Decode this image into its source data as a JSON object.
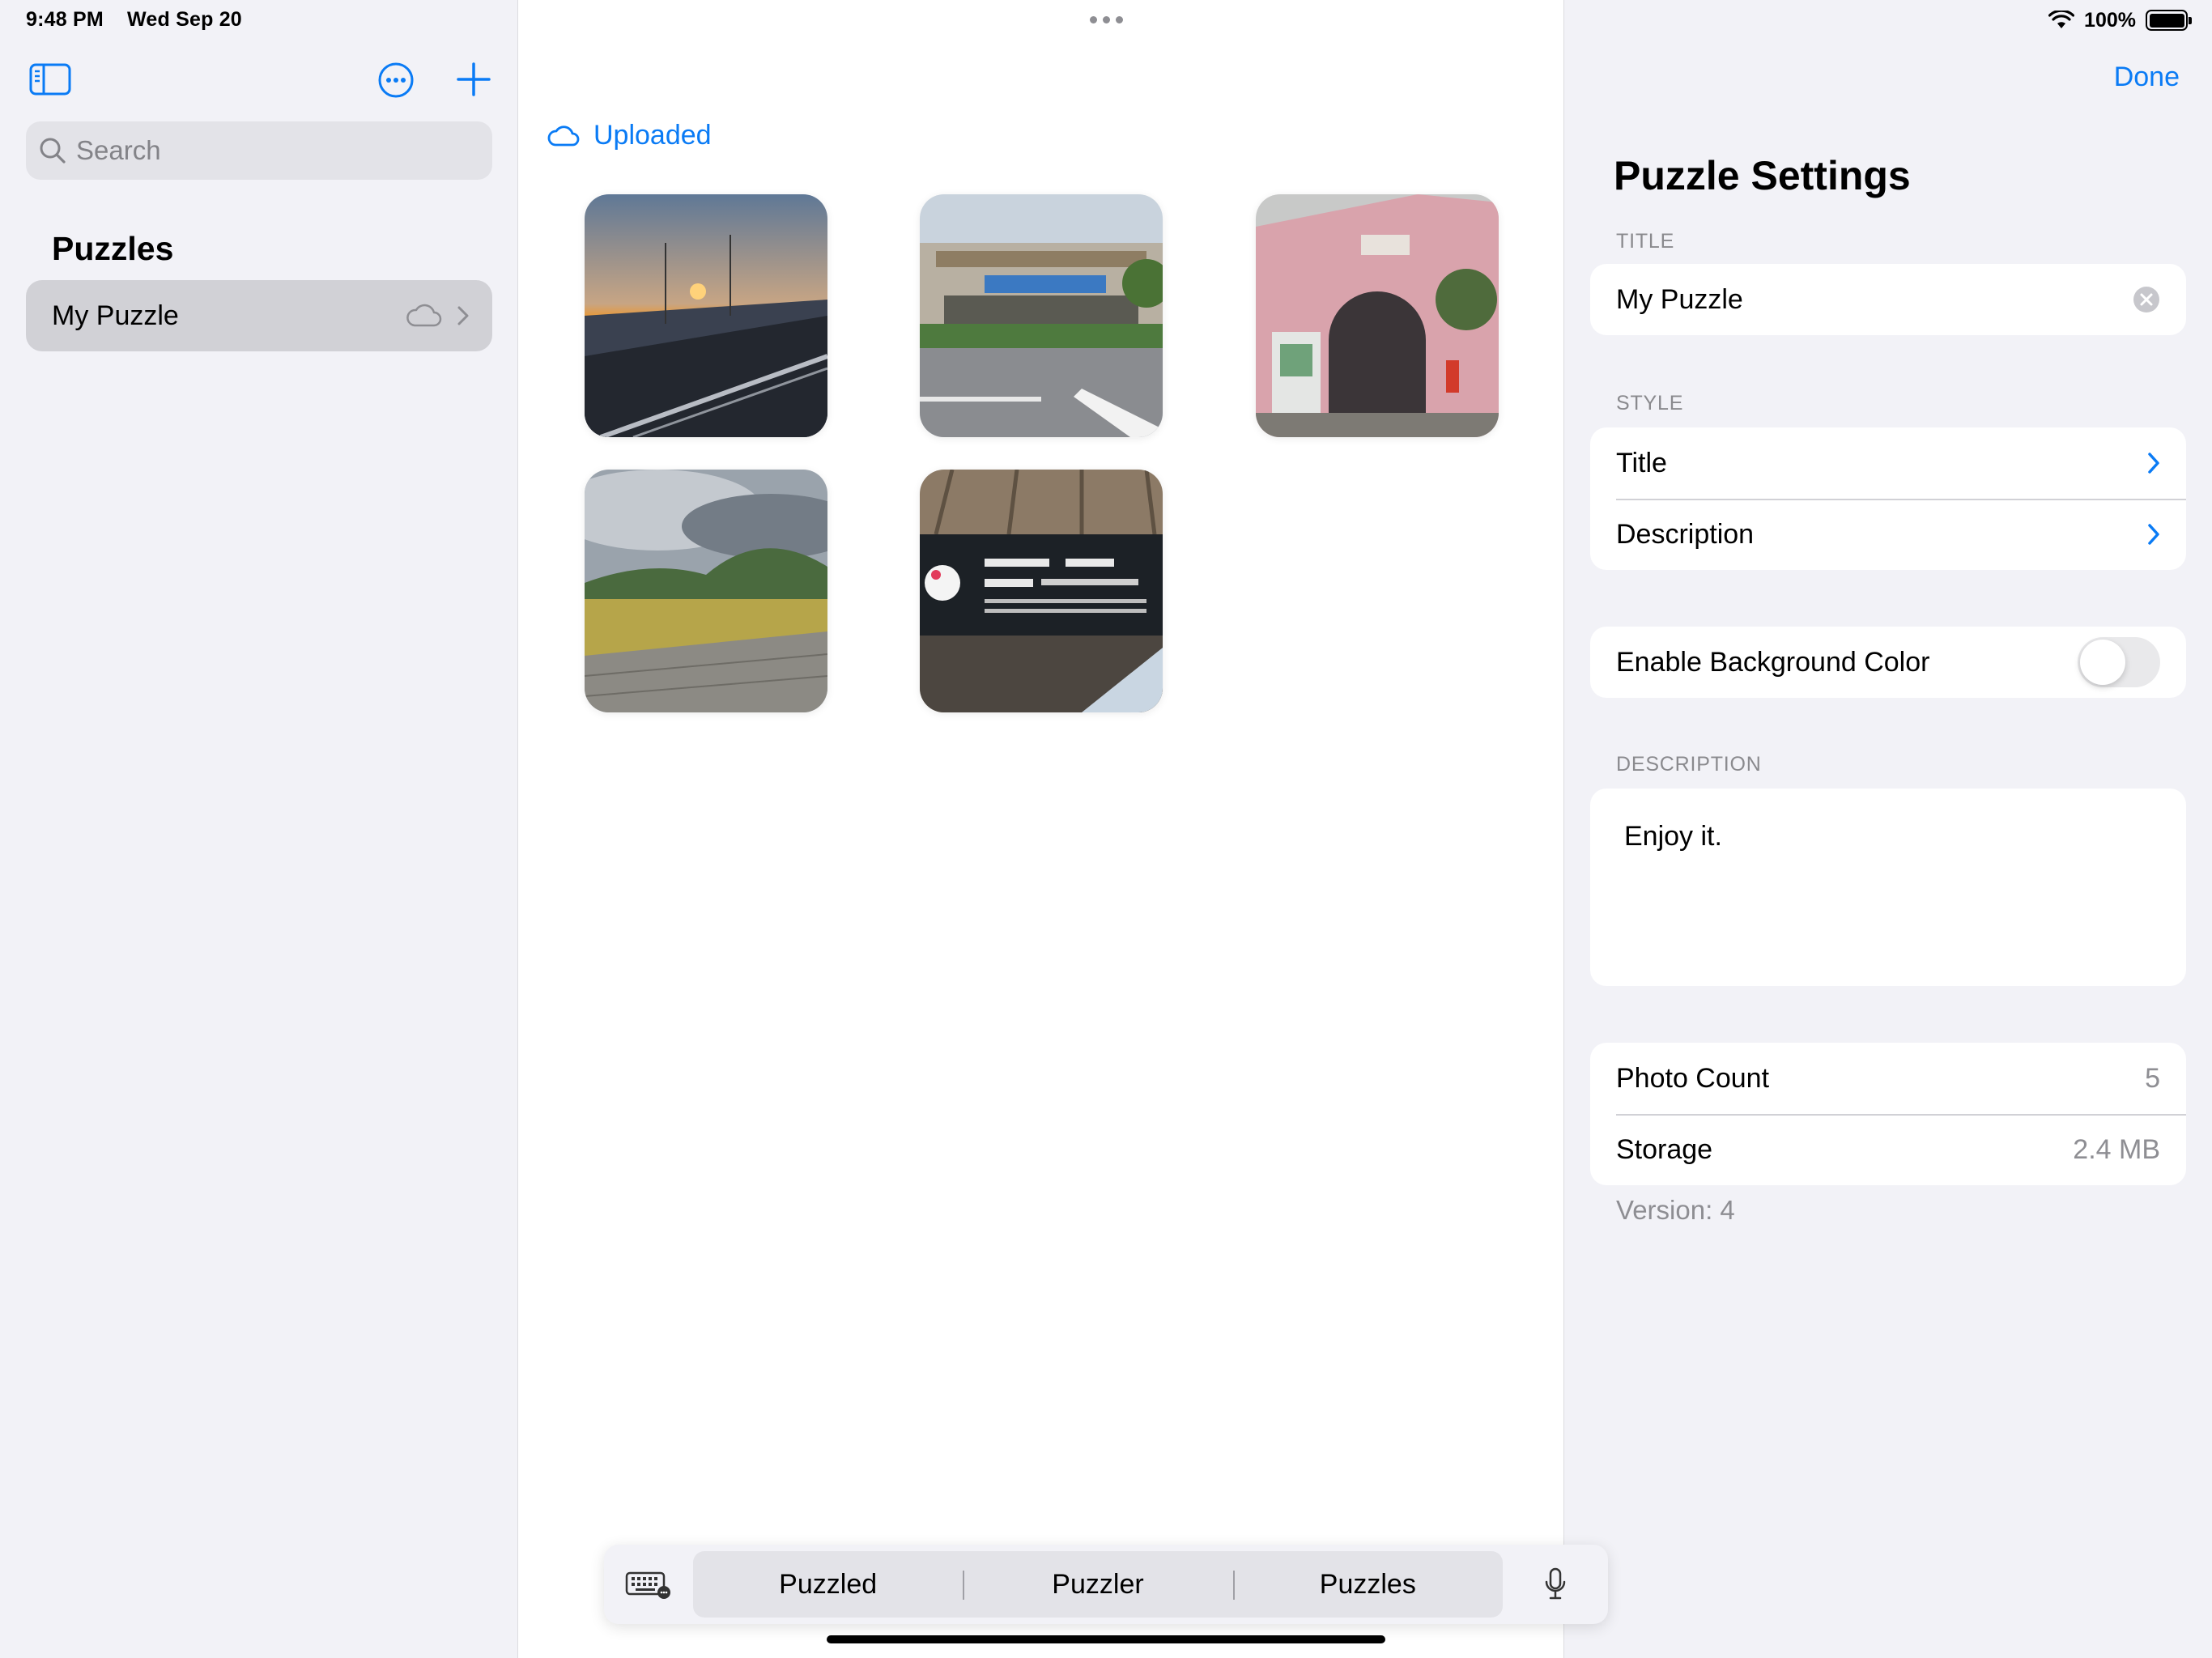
{
  "status_bar": {
    "time": "9:48 PM",
    "date": "Wed Sep 20",
    "battery": "100%"
  },
  "sidebar": {
    "search_placeholder": "Search",
    "section_title": "Puzzles",
    "items": [
      {
        "label": "My Puzzle",
        "icon": "cloud-icon"
      }
    ]
  },
  "content": {
    "upload_status": "Uploaded",
    "photos": [
      {
        "name": "photo-sunset-bridge"
      },
      {
        "name": "photo-storefront"
      },
      {
        "name": "photo-pink-station"
      },
      {
        "name": "photo-rice-field"
      },
      {
        "name": "photo-station-sign"
      }
    ]
  },
  "settings": {
    "done_label": "Done",
    "title": "Puzzle Settings",
    "title_section_label": "TITLE",
    "title_value": "My Puzzle",
    "style_section_label": "STYLE",
    "style_rows": [
      "Title",
      "Description"
    ],
    "background_toggle_label": "Enable Background Color",
    "background_toggle_on": false,
    "description_section_label": "DESCRIPTION",
    "description_value": "Enjoy it.",
    "info_rows": [
      {
        "label": "Photo Count",
        "value": "5"
      },
      {
        "label": "Storage",
        "value": "2.4 MB"
      }
    ],
    "version": "Version: 4"
  },
  "keyboard_bar": {
    "predictions": [
      "Puzzled",
      "Puzzler",
      "Puzzles"
    ]
  },
  "colors": {
    "accent": "#0a7bf5",
    "selected_row": "#d1d1d6"
  }
}
